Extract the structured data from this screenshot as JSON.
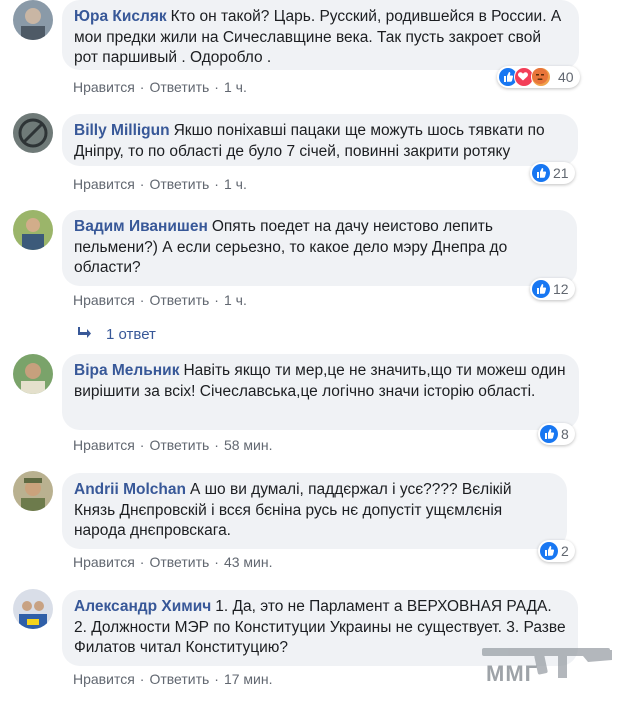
{
  "actions": {
    "like": "Нравится",
    "reply": "Ответить",
    "sep": "·"
  },
  "comments": [
    {
      "author": "Юра Кисляк",
      "text": "Кто он такой? Царь. Русский, родившейся в России. А мои предки жили на Сичеславщине века. Так пусть закроет свой рот паршивый . Одоробло .",
      "time": "1 ч.",
      "reactions": "40",
      "reaction_types": [
        "like-icon",
        "love-icon",
        "angry-icon"
      ]
    },
    {
      "author": "Billy Milligun",
      "text": "Якшо поніхавші пацаки ще можуть шось тявкати по Дніпру, то по області де було 7 січей, повинні закрити ротяку",
      "time": "1 ч.",
      "reactions": "21",
      "reaction_types": [
        "like-icon"
      ]
    },
    {
      "author": "Вадим Иванишен",
      "text": "Опять поедет на дачу неистово лепить пельмени?) А если серьезно, то какое дело мэру Днепра до области?",
      "time": "1 ч.",
      "reactions": "12",
      "reaction_types": [
        "like-icon"
      ],
      "replies": "1 ответ"
    },
    {
      "author": "Віра Мельник",
      "text": "Навіть якщо ти мер,це не значить,що ти можеш один вирішити за всіх! Січеславська,це логічно значи історію області.",
      "time": "58 мин.",
      "reactions": "8",
      "reaction_types": [
        "like-icon"
      ]
    },
    {
      "author": "Andrii Molchan",
      "text": "А шо ви думалі, паддєржал і усє???? Вєлікій Князь Днєпровскій і всєя бєніна русь нє допустіт ущємлєнія народа днєпровскага.",
      "time": "43 мин.",
      "reactions": "2",
      "reaction_types": [
        "like-icon"
      ]
    },
    {
      "author": "Александр Химич",
      "text": "1. Да, это не Парламент а ВЕРХОВНАЯ РАДА. 2. Должности МЭР по Конституции Украины не существует. 3. Разве Филатов читал Конституцию?",
      "time": "17 мин."
    }
  ],
  "watermark": "ММГ",
  "colors": {
    "link": "#385898",
    "bubble": "#f0f2f5",
    "like": "#1877f2",
    "meta": "#616770"
  }
}
